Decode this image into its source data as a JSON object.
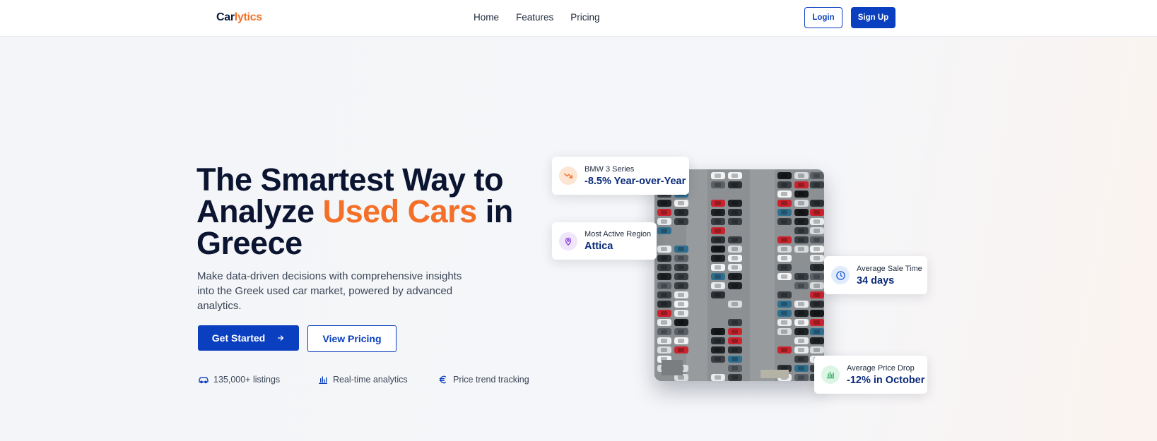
{
  "brand": {
    "name_part1": "Car",
    "name_part2": "lytics"
  },
  "nav": {
    "links": [
      "Home",
      "Features",
      "Pricing"
    ],
    "login_label": "Login",
    "signup_label": "Sign Up"
  },
  "hero": {
    "title_line1": "The Smartest Way to",
    "title_line2_start": "Analyze ",
    "title_accent": "Used Cars",
    "title_line2_end": " in",
    "title_line3": "Greece",
    "subtitle": "Make data-driven decisions with comprehensive insights into the Greek used car market, powered by advanced analytics.",
    "primary_button": "Get Started",
    "secondary_button": "View Pricing",
    "features": [
      {
        "icon": "car-icon",
        "label": "135,000+ listings"
      },
      {
        "icon": "bar-chart-icon",
        "label": "Real-time analytics"
      },
      {
        "icon": "euro-icon",
        "label": "Price trend tracking"
      }
    ]
  },
  "stats": [
    {
      "icon": "trending-down-icon",
      "label": "BMW 3 Series",
      "value": "-8.5% Year-over-Year"
    },
    {
      "icon": "map-pin-icon",
      "label": "Most Active Region",
      "value": "Attica"
    },
    {
      "icon": "clock-icon",
      "label": "Average Sale Time",
      "value": "34 days"
    },
    {
      "icon": "bar-chart-icon",
      "label": "Average Price Drop",
      "value": "-12% in October"
    }
  ],
  "colors": {
    "primary": "#0a3fbf",
    "accent": "#f47029",
    "heading": "#0b1430",
    "value": "#0a2a7a"
  }
}
